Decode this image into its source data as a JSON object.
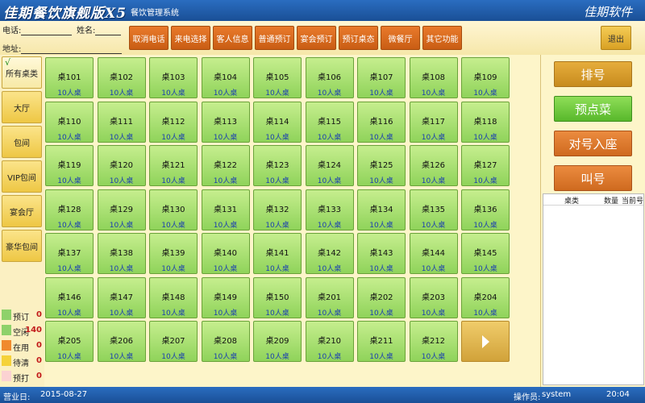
{
  "title": {
    "app_name": "佳期餐饮旗舰版X5",
    "subtitle": "餐饮管理系统",
    "brand": "佳期软件"
  },
  "toolbar": {
    "phone_label": "电话:",
    "name_label": "姓名:",
    "address_label": "地址:",
    "buttons": [
      "取消电话",
      "来电选择",
      "客人信息",
      "普通预订",
      "宴会预订",
      "预订桌态",
      "微餐厅",
      "其它功能"
    ],
    "exit_label": "退出"
  },
  "categories": {
    "items": [
      {
        "label": "所有桌类",
        "active": true
      },
      {
        "label": "大厅",
        "active": false
      },
      {
        "label": "包间",
        "active": false
      },
      {
        "label": "VIP包间",
        "active": false
      },
      {
        "label": "宴会厅",
        "active": false
      },
      {
        "label": "豪华包间",
        "active": false
      }
    ],
    "check_mark": "√"
  },
  "legend": [
    {
      "label": "预订",
      "count": "0",
      "color": "#8ed16a"
    },
    {
      "label": "空闲",
      "count": "140",
      "color": "#8ed16a"
    },
    {
      "label": "在用",
      "count": "0",
      "color": "#f08a2e"
    },
    {
      "label": "待清",
      "count": "0",
      "color": "#f5d23a"
    },
    {
      "label": "预打",
      "count": "0",
      "color": "#fbd2d2"
    }
  ],
  "tables": [
    {
      "name": "桌101",
      "capacity": "10人桌"
    },
    {
      "name": "桌102",
      "capacity": "10人桌"
    },
    {
      "name": "桌103",
      "capacity": "10人桌"
    },
    {
      "name": "桌104",
      "capacity": "10人桌"
    },
    {
      "name": "桌105",
      "capacity": "10人桌"
    },
    {
      "name": "桌106",
      "capacity": "10人桌"
    },
    {
      "name": "桌107",
      "capacity": "10人桌"
    },
    {
      "name": "桌108",
      "capacity": "10人桌"
    },
    {
      "name": "桌109",
      "capacity": "10人桌"
    },
    {
      "name": "桌110",
      "capacity": "10人桌"
    },
    {
      "name": "桌111",
      "capacity": "10人桌"
    },
    {
      "name": "桌112",
      "capacity": "10人桌"
    },
    {
      "name": "桌113",
      "capacity": "10人桌"
    },
    {
      "name": "桌114",
      "capacity": "10人桌"
    },
    {
      "name": "桌115",
      "capacity": "10人桌"
    },
    {
      "name": "桌116",
      "capacity": "10人桌"
    },
    {
      "name": "桌117",
      "capacity": "10人桌"
    },
    {
      "name": "桌118",
      "capacity": "10人桌"
    },
    {
      "name": "桌119",
      "capacity": "10人桌"
    },
    {
      "name": "桌120",
      "capacity": "10人桌"
    },
    {
      "name": "桌121",
      "capacity": "10人桌"
    },
    {
      "name": "桌122",
      "capacity": "10人桌"
    },
    {
      "name": "桌123",
      "capacity": "10人桌"
    },
    {
      "name": "桌124",
      "capacity": "10人桌"
    },
    {
      "name": "桌125",
      "capacity": "10人桌"
    },
    {
      "name": "桌126",
      "capacity": "10人桌"
    },
    {
      "name": "桌127",
      "capacity": "10人桌"
    },
    {
      "name": "桌128",
      "capacity": "10人桌"
    },
    {
      "name": "桌129",
      "capacity": "10人桌"
    },
    {
      "name": "桌130",
      "capacity": "10人桌"
    },
    {
      "name": "桌131",
      "capacity": "10人桌"
    },
    {
      "name": "桌132",
      "capacity": "10人桌"
    },
    {
      "name": "桌133",
      "capacity": "10人桌"
    },
    {
      "name": "桌134",
      "capacity": "10人桌"
    },
    {
      "name": "桌135",
      "capacity": "10人桌"
    },
    {
      "name": "桌136",
      "capacity": "10人桌"
    },
    {
      "name": "桌137",
      "capacity": "10人桌"
    },
    {
      "name": "桌138",
      "capacity": "10人桌"
    },
    {
      "name": "桌139",
      "capacity": "10人桌"
    },
    {
      "name": "桌140",
      "capacity": "10人桌"
    },
    {
      "name": "桌141",
      "capacity": "10人桌"
    },
    {
      "name": "桌142",
      "capacity": "10人桌"
    },
    {
      "name": "桌143",
      "capacity": "10人桌"
    },
    {
      "name": "桌144",
      "capacity": "10人桌"
    },
    {
      "name": "桌145",
      "capacity": "10人桌"
    },
    {
      "name": "桌146",
      "capacity": "10人桌"
    },
    {
      "name": "桌147",
      "capacity": "10人桌"
    },
    {
      "name": "桌148",
      "capacity": "10人桌"
    },
    {
      "name": "桌149",
      "capacity": "10人桌"
    },
    {
      "name": "桌150",
      "capacity": "10人桌"
    },
    {
      "name": "桌201",
      "capacity": "10人桌"
    },
    {
      "name": "桌202",
      "capacity": "10人桌"
    },
    {
      "name": "桌203",
      "capacity": "10人桌"
    },
    {
      "name": "桌204",
      "capacity": "10人桌"
    },
    {
      "name": "桌205",
      "capacity": "10人桌"
    },
    {
      "name": "桌206",
      "capacity": "10人桌"
    },
    {
      "name": "桌207",
      "capacity": "10人桌"
    },
    {
      "name": "桌208",
      "capacity": "10人桌"
    },
    {
      "name": "桌209",
      "capacity": "10人桌"
    },
    {
      "name": "桌210",
      "capacity": "10人桌"
    },
    {
      "name": "桌211",
      "capacity": "10人桌"
    },
    {
      "name": "桌212",
      "capacity": "10人桌"
    }
  ],
  "actions": {
    "queue_number": "排号",
    "preorder": "预点菜",
    "seat_by_number": "对号入座",
    "call_number": "叫号"
  },
  "queue_list": {
    "headers": [
      "桌类",
      "数量",
      "当前号"
    ]
  },
  "statusbar": {
    "date_label": "营业日:",
    "date": "2015-08-27",
    "operator_label": "操作员:",
    "operator": "system",
    "time": "20:04"
  }
}
